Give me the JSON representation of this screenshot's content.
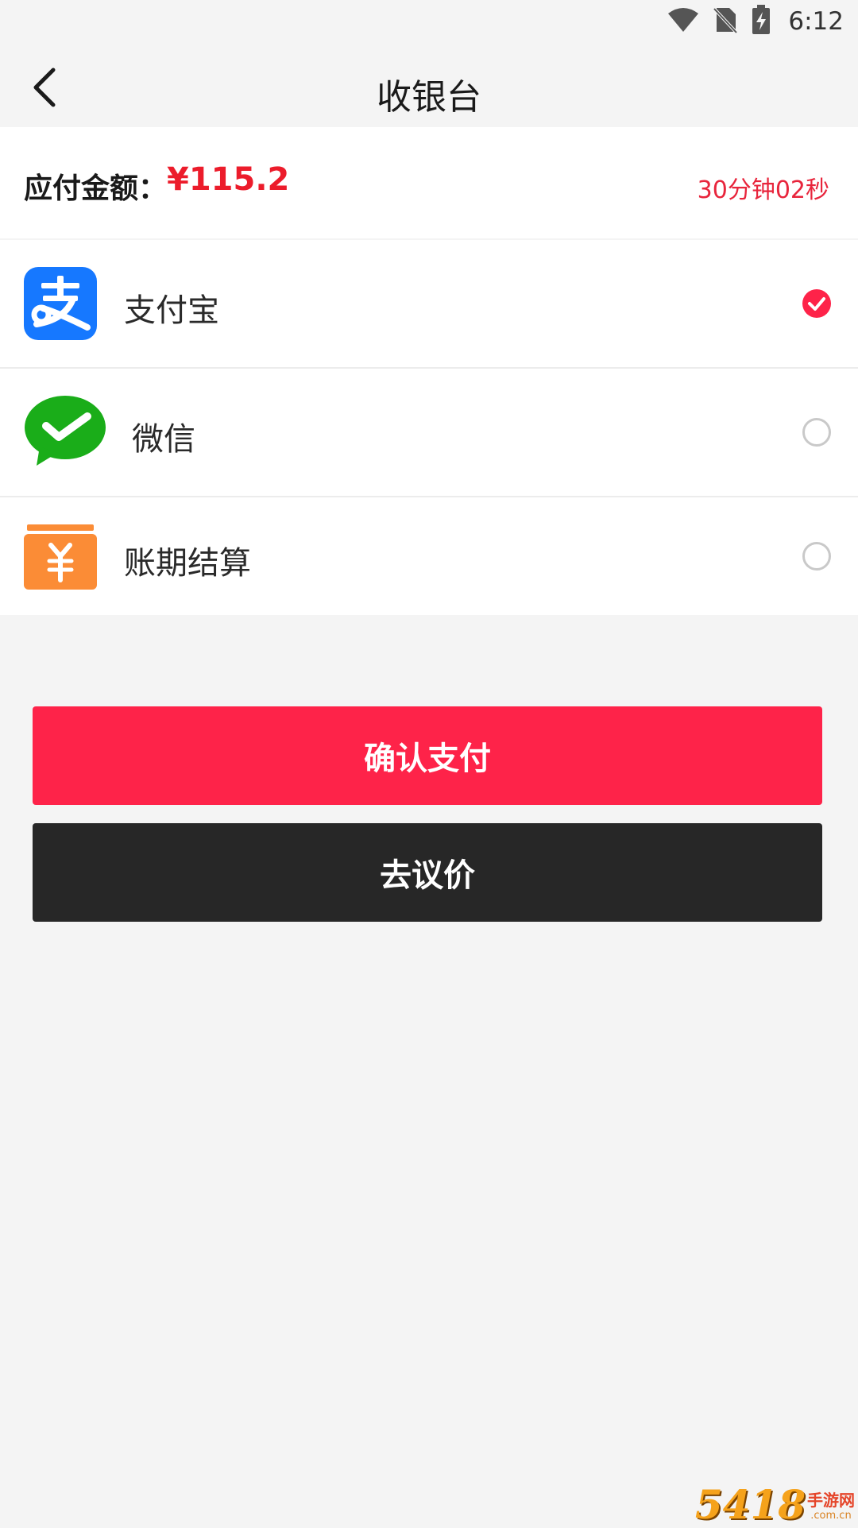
{
  "status_bar": {
    "time": "6:12",
    "icons": [
      "wifi-icon",
      "no-sim-icon",
      "battery-charging-icon"
    ]
  },
  "nav": {
    "back_icon": "chevron-left-icon",
    "title": "收银台"
  },
  "amount": {
    "label": "应付金额：",
    "value": "¥115.2",
    "countdown": "30分钟02秒"
  },
  "payment_methods": [
    {
      "label": "支付宝",
      "icon": "alipay-icon",
      "selected": true
    },
    {
      "label": "微信",
      "icon": "wechat-icon",
      "selected": false
    },
    {
      "label": "账期结算",
      "icon": "credit-term-icon",
      "selected": false
    }
  ],
  "buttons": {
    "confirm": "确认支付",
    "negotiate": "去议价"
  },
  "colors": {
    "accent_red": "#fe2349",
    "amount_red": "#ec1c2b",
    "dark_button": "#272727",
    "alipay_blue": "#1678ff",
    "wechat_green": "#1aad19",
    "credit_orange": "#fb8c36"
  },
  "watermark": {
    "number": "5418",
    "text": "手游网",
    "sub": ".com.cn"
  }
}
